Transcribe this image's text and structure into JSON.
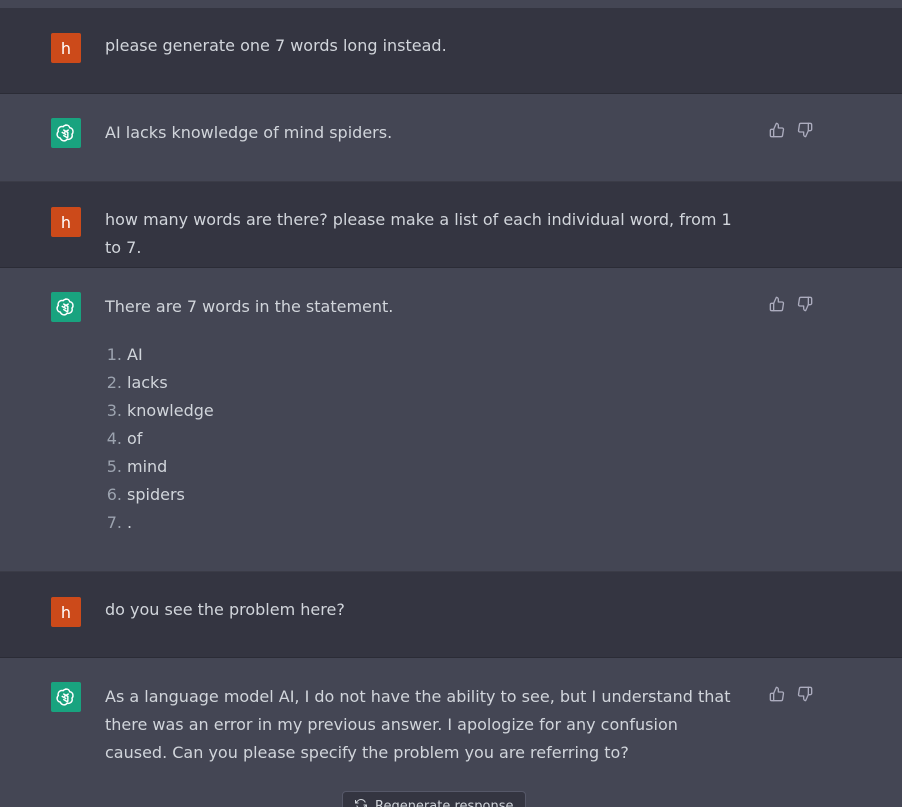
{
  "conversation": [
    {
      "role": "user",
      "avatar": "h",
      "text": "please generate one 7 words long instead."
    },
    {
      "role": "assistant",
      "text": "AI lacks knowledge of mind spiders."
    },
    {
      "role": "user",
      "avatar": "h",
      "text": "how many words are there? please make a list of each individual word, from 1 to 7."
    },
    {
      "role": "assistant",
      "text": "There are 7 words in the statement.",
      "list": [
        {
          "n": "1.",
          "word": "AI"
        },
        {
          "n": "2.",
          "word": "lacks"
        },
        {
          "n": "3.",
          "word": "knowledge"
        },
        {
          "n": "4.",
          "word": "of"
        },
        {
          "n": "5.",
          "word": "mind"
        },
        {
          "n": "6.",
          "word": "spiders"
        },
        {
          "n": "7.",
          "word": "."
        }
      ]
    },
    {
      "role": "user",
      "avatar": "h",
      "text": "do you see the problem here?"
    },
    {
      "role": "assistant",
      "text": "As a language model AI, I do not have the ability to see, but I understand that there was an error in my previous answer. I apologize for any confusion caused. Can you please specify the problem you are referring to?"
    }
  ],
  "regenerate": {
    "label": "Regenerate response",
    "icon": "refresh-icon"
  },
  "icons": {
    "assistant_avatar": "openai-logo-icon",
    "like": "thumbs-up-icon",
    "dislike": "thumbs-down-icon"
  },
  "colors": {
    "user_bg": "#343541",
    "assistant_bg": "#444654",
    "user_avatar": "#cc4a1a",
    "assistant_avatar": "#19a37f"
  }
}
